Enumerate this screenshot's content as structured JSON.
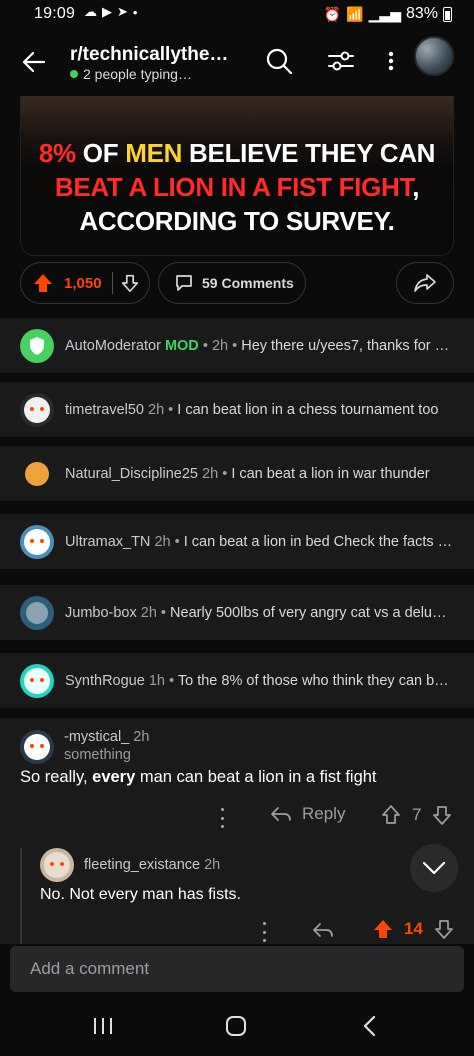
{
  "status_bar": {
    "time": "19:09",
    "left_icons": [
      "cloud-icon",
      "youtube-icon",
      "telegram-icon",
      "dot-icon"
    ],
    "right_icons": [
      "alarm-icon",
      "wifi-icon",
      "signal-icon"
    ],
    "battery": "83%"
  },
  "header": {
    "subreddit": "r/technicallythe…",
    "typing": "2 people typing…"
  },
  "post": {
    "headline_l1_a": "8%",
    "headline_l1_b": "OF",
    "headline_l1_c": "MEN",
    "headline_l1_d": "BELIEVE THEY CAN",
    "headline_l2": "BEAT A LION IN A FIST FIGHT",
    "headline_l2_comma": ",",
    "headline_l3": "ACCORDING TO SURVEY."
  },
  "actions": {
    "votes": "1,050",
    "comments": "59 Comments"
  },
  "collapsed_comments": [
    {
      "user": "AutoModerator",
      "badge": "MOD",
      "time": "2h",
      "snippet": "Hey there u/yees7, thanks for …"
    },
    {
      "user": "timetravel50",
      "time": "2h",
      "snippet": "I can beat lion in a chess tournament too"
    },
    {
      "user": "Natural_Discipline25",
      "time": "2h",
      "snippet": "I can beat a lion in war thunder"
    },
    {
      "user": "Ultramax_TN",
      "time": "2h",
      "snippet": "I can beat a lion in bed Check the facts …"
    },
    {
      "user": "Jumbo-box",
      "time": "2h",
      "snippet": "Nearly 500lbs of very angry cat vs a delu…"
    },
    {
      "user": "SynthRogue",
      "time": "1h",
      "snippet": "To the 8% of those who think they can b…"
    }
  ],
  "expanded_comment": {
    "user": "-mystical_",
    "time": "2h",
    "flair": "something",
    "body_a": "So really, ",
    "body_b": "every",
    "body_c": " man can beat a lion in a fist fight",
    "reply_label": "Reply",
    "score": "7"
  },
  "reply_comment": {
    "user": "fleeting_existance",
    "time": "2h",
    "body": "No. Not every man has fists.",
    "score": "14"
  },
  "composer": {
    "placeholder": "Add a comment"
  },
  "colors": {
    "upvote": "#ff4500",
    "online": "#46d160",
    "mod": "#46d160"
  }
}
